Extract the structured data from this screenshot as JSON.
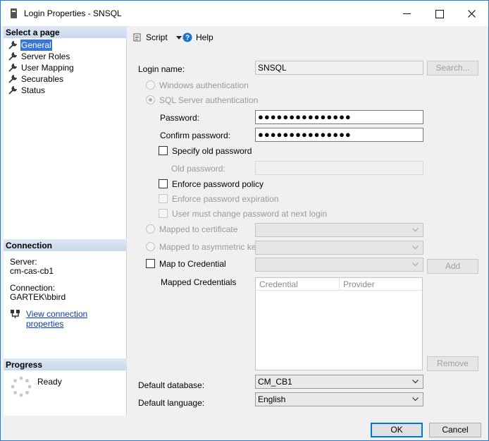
{
  "window": {
    "title": "Login Properties - SNSQL"
  },
  "sidebar": {
    "select_header": "Select a page",
    "pages": [
      {
        "label": "General",
        "selected": true
      },
      {
        "label": "Server Roles",
        "selected": false
      },
      {
        "label": "User Mapping",
        "selected": false
      },
      {
        "label": "Securables",
        "selected": false
      },
      {
        "label": "Status",
        "selected": false
      }
    ],
    "connection_header": "Connection",
    "server_label": "Server:",
    "server_value": "cm-cas-cb1",
    "connection_label": "Connection:",
    "connection_value": "GARTEK\\bbird",
    "view_link": "View connection properties",
    "progress_header": "Progress",
    "progress_status": "Ready"
  },
  "toolbar": {
    "script_label": "Script",
    "help_label": "Help"
  },
  "form": {
    "login_name_label": "Login name:",
    "login_name_value": "SNSQL",
    "search_button": "Search...",
    "windows_auth": "Windows authentication",
    "sql_auth": "SQL Server authentication",
    "password_label": "Password:",
    "password_value": "●●●●●●●●●●●●●●●",
    "confirm_label": "Confirm password:",
    "confirm_value": "●●●●●●●●●●●●●●●",
    "specify_old": "Specify old password",
    "old_password_label": "Old password:",
    "enforce_policy": "Enforce password policy",
    "enforce_expiration": "Enforce password expiration",
    "must_change": "User must change password at next login",
    "mapped_cert": "Mapped to certificate",
    "mapped_asym": "Mapped to asymmetric key",
    "map_credential": "Map to Credential",
    "add_button": "Add",
    "mapped_credentials_label": "Mapped Credentials",
    "grid_col_credential": "Credential",
    "grid_col_provider": "Provider",
    "remove_button": "Remove",
    "default_db_label": "Default database:",
    "default_db_value": "CM_CB1",
    "default_lang_label": "Default language:",
    "default_lang_value": "English"
  },
  "footer": {
    "ok": "OK",
    "cancel": "Cancel"
  },
  "icons": {
    "app": "database-icon",
    "page": "wrench-icon",
    "script": "script-icon",
    "help": "help-icon",
    "connection": "connection-icon",
    "progress": "spinner-icon"
  }
}
